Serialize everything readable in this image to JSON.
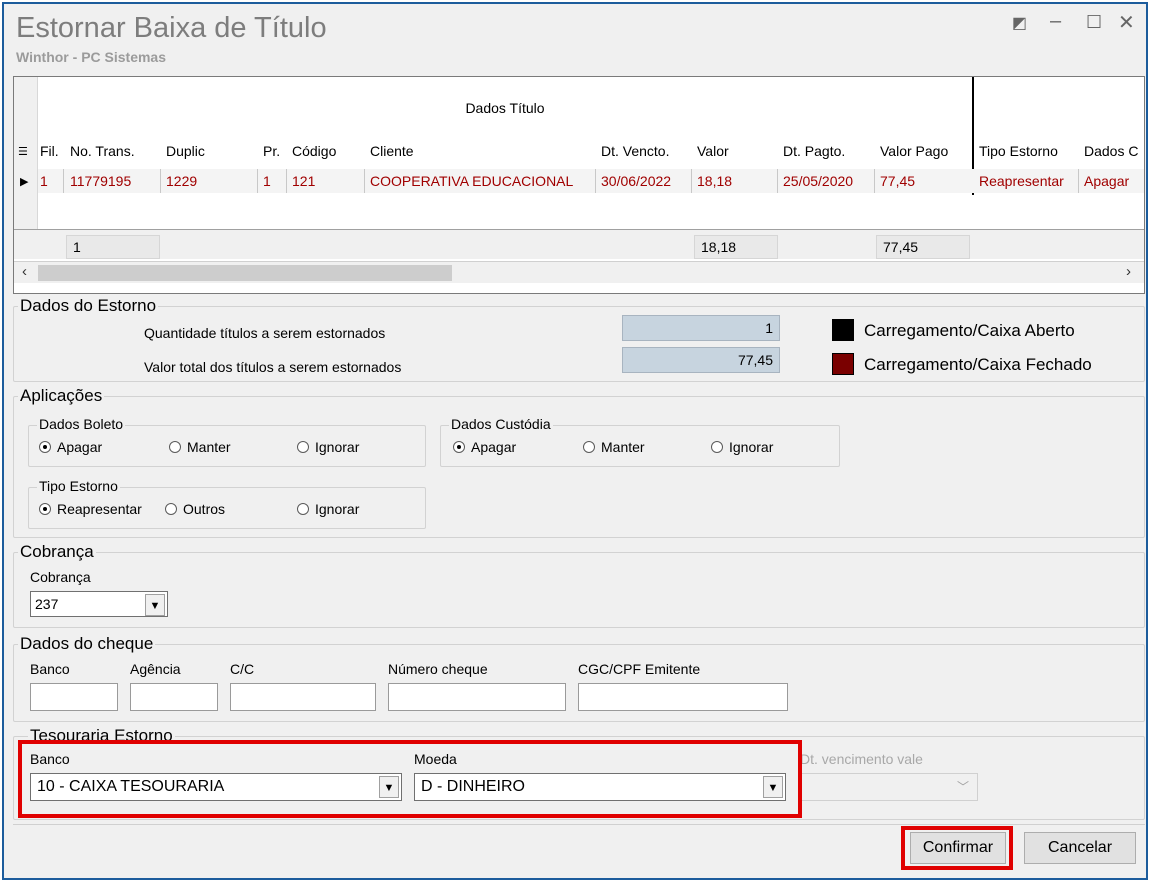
{
  "window": {
    "title": "Estornar Baixa de Título",
    "subtitle": "Winthor - PC Sistemas"
  },
  "grid": {
    "band_title": "Dados Título",
    "headers": [
      "Fil.",
      "No. Trans.",
      "Duplic",
      "Pr.",
      "Código",
      "Cliente",
      "Dt. Vencto.",
      "Valor",
      "Dt. Pagto.",
      "Valor Pago",
      "Tipo Estorno",
      "Dados C"
    ],
    "row": [
      "1",
      "11779195",
      "1229",
      "1",
      "121",
      "COOPERATIVA EDUCACIONAL",
      "30/06/2022",
      "18,18",
      "25/05/2020",
      "77,45",
      "Reapresentar",
      "Apagar"
    ],
    "totals": {
      "fil": "1",
      "valor": "18,18",
      "valor_pago": "77,45"
    }
  },
  "dados_estorno": {
    "legend": "Dados do Estorno",
    "qtd_label": "Quantidade títulos a serem estornados",
    "qtd_value": "1",
    "valor_label": "Valor total dos títulos a serem estornados",
    "valor_value": "77,45",
    "color_legend": [
      {
        "label": "Carregamento/Caixa Aberto",
        "color": "#000000"
      },
      {
        "label": "Carregamento/Caixa Fechado",
        "color": "#7a0000"
      }
    ]
  },
  "aplicacoes": {
    "legend": "Aplicações",
    "dados_boleto": {
      "legend": "Dados Boleto",
      "options": [
        "Apagar",
        "Manter",
        "Ignorar"
      ],
      "selected": "Apagar"
    },
    "dados_custodia": {
      "legend": "Dados Custódia",
      "options": [
        "Apagar",
        "Manter",
        "Ignorar"
      ],
      "selected": "Apagar"
    },
    "tipo_estorno": {
      "legend": "Tipo Estorno",
      "options": [
        "Reapresentar",
        "Outros",
        "Ignorar"
      ],
      "selected": "Reapresentar"
    }
  },
  "cobranca": {
    "legend": "Cobrança",
    "label": "Cobrança",
    "value": "237"
  },
  "cheque": {
    "legend": "Dados do cheque",
    "banco_label": "Banco",
    "agencia_label": "Agência",
    "cc_label": "C/C",
    "numero_label": "Número cheque",
    "cgc_label": "CGC/CPF Emitente"
  },
  "tesouraria": {
    "legend": "Tesouraria Estorno",
    "banco_label": "Banco",
    "banco_value": "10 - CAIXA TESOURARIA",
    "moeda_label": "Moeda",
    "moeda_value": "D - DINHEIRO",
    "vencimento_label": "Dt. vencimento vale"
  },
  "buttons": {
    "confirmar": "Confirmar",
    "cancelar": "Cancelar"
  },
  "colors": {
    "highlight": "#e00000",
    "row_text": "#a00000"
  }
}
